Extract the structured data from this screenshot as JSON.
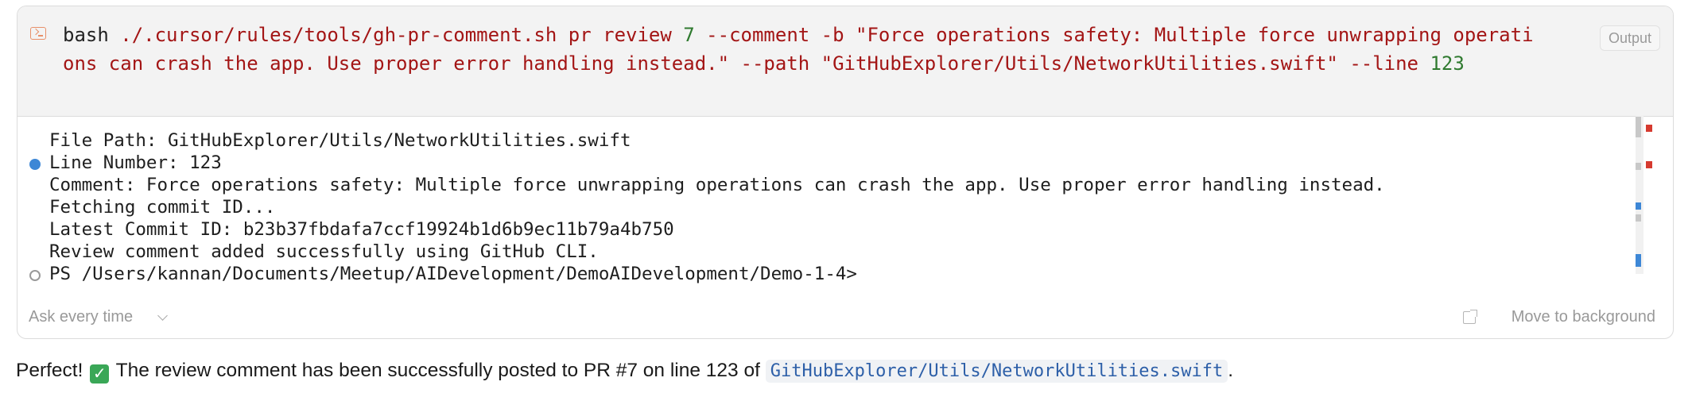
{
  "command": {
    "icon": "terminal-icon",
    "prefix": "bash ",
    "script_path": "./.cursor/rules/tools/gh-pr-comment.sh pr review ",
    "pr_number": "7",
    "args": " --comment -b \"Force operations safety: Multiple force unwrapping operations can crash the app. Use proper error handling instead.\" --path \"GitHubExplorer/Utils/NetworkUtilities.swift\" --line ",
    "line_number": "123",
    "output_label": "Output"
  },
  "output": {
    "lines": [
      "File Path: GitHubExplorer/Utils/NetworkUtilities.swift",
      "Line Number: 123",
      "Comment: Force operations safety: Multiple force unwrapping operations can crash the app. Use proper error handling instead.",
      "Fetching commit ID...",
      "Latest Commit ID: b23b37fbdafa7ccf19924b1d6b9ec11b79a4b750",
      "Review comment added successfully using GitHub CLI.",
      "PS /Users/kannan/Documents/Meetup/AIDevelopment/DemoAIDevelopment/Demo-1-4>"
    ]
  },
  "footer": {
    "ask_label": "Ask every time",
    "move_label": "Move to background"
  },
  "message": {
    "prefix": "Perfect! ",
    "check": "✓",
    "text": " The review comment has been successfully posted to PR #7 on line 123 of ",
    "file_path": "GitHubExplorer/Utils/NetworkUtilities.swift",
    "suffix": "."
  },
  "colors": {
    "string_red": "#a31515",
    "number_green": "#2f7a2f",
    "accent_blue": "#3d87d6",
    "check_green": "#3aa757"
  }
}
